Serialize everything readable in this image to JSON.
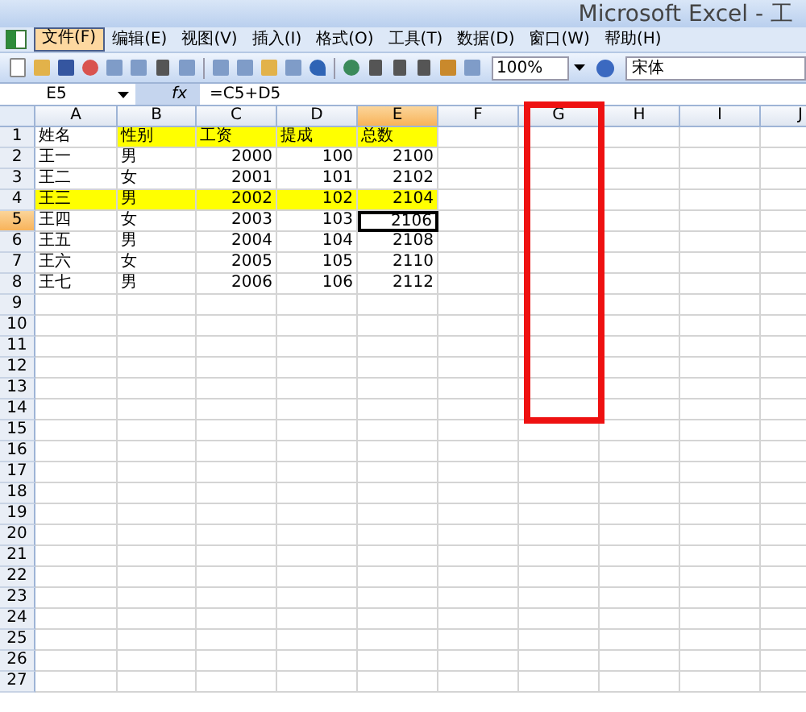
{
  "window": {
    "title": "Microsoft Excel - 工"
  },
  "menu": [
    {
      "label": "文件(F)",
      "selected": true
    },
    {
      "label": "编辑(E)",
      "selected": false
    },
    {
      "label": "视图(V)",
      "selected": false
    },
    {
      "label": "插入(I)",
      "selected": false
    },
    {
      "label": "格式(O)",
      "selected": false
    },
    {
      "label": "工具(T)",
      "selected": false
    },
    {
      "label": "数据(D)",
      "selected": false
    },
    {
      "label": "窗口(W)",
      "selected": false
    },
    {
      "label": "帮助(H)",
      "selected": false
    }
  ],
  "toolbar": {
    "zoom": "100%",
    "font": "宋体"
  },
  "formula_bar": {
    "name_box": "E5",
    "fx": "fx",
    "formula": "=C5+D5"
  },
  "columns": [
    {
      "label": "A",
      "selected": false
    },
    {
      "label": "B",
      "selected": false
    },
    {
      "label": "C",
      "selected": false
    },
    {
      "label": "D",
      "selected": false
    },
    {
      "label": "E",
      "selected": true
    },
    {
      "label": "F",
      "selected": false
    },
    {
      "label": "G",
      "selected": false
    },
    {
      "label": "H",
      "selected": false
    },
    {
      "label": "I",
      "selected": false
    },
    {
      "label": "J",
      "selected": false
    }
  ],
  "rows": [
    {
      "number": "1",
      "selected": false,
      "cells": [
        {
          "text": "姓名",
          "kind": "text",
          "highlighted": false,
          "selected": false
        },
        {
          "text": "性别",
          "kind": "text",
          "highlighted": true,
          "selected": false
        },
        {
          "text": "工资",
          "kind": "text",
          "highlighted": true,
          "selected": false
        },
        {
          "text": "提成",
          "kind": "text",
          "highlighted": true,
          "selected": false
        },
        {
          "text": "总数",
          "kind": "text",
          "highlighted": true,
          "selected": false
        }
      ]
    },
    {
      "number": "2",
      "selected": false,
      "cells": [
        {
          "text": "王一",
          "kind": "text",
          "highlighted": false,
          "selected": false
        },
        {
          "text": "男",
          "kind": "text",
          "highlighted": false,
          "selected": false
        },
        {
          "text": "2000",
          "kind": "number",
          "highlighted": false,
          "selected": false
        },
        {
          "text": "100",
          "kind": "number",
          "highlighted": false,
          "selected": false
        },
        {
          "text": "2100",
          "kind": "number",
          "highlighted": false,
          "selected": false
        }
      ]
    },
    {
      "number": "3",
      "selected": false,
      "cells": [
        {
          "text": "王二",
          "kind": "text",
          "highlighted": false,
          "selected": false
        },
        {
          "text": "女",
          "kind": "text",
          "highlighted": false,
          "selected": false
        },
        {
          "text": "2001",
          "kind": "number",
          "highlighted": false,
          "selected": false
        },
        {
          "text": "101",
          "kind": "number",
          "highlighted": false,
          "selected": false
        },
        {
          "text": "2102",
          "kind": "number",
          "highlighted": false,
          "selected": false
        }
      ]
    },
    {
      "number": "4",
      "selected": false,
      "cells": [
        {
          "text": "王三",
          "kind": "text",
          "highlighted": true,
          "selected": false
        },
        {
          "text": "男",
          "kind": "text",
          "highlighted": true,
          "selected": false
        },
        {
          "text": "2002",
          "kind": "number",
          "highlighted": true,
          "selected": false
        },
        {
          "text": "102",
          "kind": "number",
          "highlighted": true,
          "selected": false
        },
        {
          "text": "2104",
          "kind": "number",
          "highlighted": true,
          "selected": false
        }
      ]
    },
    {
      "number": "5",
      "selected": true,
      "cells": [
        {
          "text": "王四",
          "kind": "text",
          "highlighted": false,
          "selected": false
        },
        {
          "text": "女",
          "kind": "text",
          "highlighted": false,
          "selected": false
        },
        {
          "text": "2003",
          "kind": "number",
          "highlighted": false,
          "selected": false
        },
        {
          "text": "103",
          "kind": "number",
          "highlighted": false,
          "selected": false
        },
        {
          "text": "2106",
          "kind": "number",
          "highlighted": false,
          "selected": true
        }
      ]
    },
    {
      "number": "6",
      "selected": false,
      "cells": [
        {
          "text": "王五",
          "kind": "text",
          "highlighted": false,
          "selected": false
        },
        {
          "text": "男",
          "kind": "text",
          "highlighted": false,
          "selected": false
        },
        {
          "text": "2004",
          "kind": "number",
          "highlighted": false,
          "selected": false
        },
        {
          "text": "104",
          "kind": "number",
          "highlighted": false,
          "selected": false
        },
        {
          "text": "2108",
          "kind": "number",
          "highlighted": false,
          "selected": false
        }
      ]
    },
    {
      "number": "7",
      "selected": false,
      "cells": [
        {
          "text": "王六",
          "kind": "text",
          "highlighted": false,
          "selected": false
        },
        {
          "text": "女",
          "kind": "text",
          "highlighted": false,
          "selected": false
        },
        {
          "text": "2005",
          "kind": "number",
          "highlighted": false,
          "selected": false
        },
        {
          "text": "105",
          "kind": "number",
          "highlighted": false,
          "selected": false
        },
        {
          "text": "2110",
          "kind": "number",
          "highlighted": false,
          "selected": false
        }
      ]
    },
    {
      "number": "8",
      "selected": false,
      "cells": [
        {
          "text": "王七",
          "kind": "text",
          "highlighted": false,
          "selected": false
        },
        {
          "text": "男",
          "kind": "text",
          "highlighted": false,
          "selected": false
        },
        {
          "text": "2006",
          "kind": "number",
          "highlighted": false,
          "selected": false
        },
        {
          "text": "106",
          "kind": "number",
          "highlighted": false,
          "selected": false
        },
        {
          "text": "2112",
          "kind": "number",
          "highlighted": false,
          "selected": false
        }
      ]
    },
    {
      "number": "9",
      "selected": false,
      "cells": []
    },
    {
      "number": "10",
      "selected": false,
      "cells": []
    },
    {
      "number": "11",
      "selected": false,
      "cells": []
    },
    {
      "number": "12",
      "selected": false,
      "cells": []
    },
    {
      "number": "13",
      "selected": false,
      "cells": []
    },
    {
      "number": "14",
      "selected": false,
      "cells": []
    },
    {
      "number": "15",
      "selected": false,
      "cells": []
    },
    {
      "number": "16",
      "selected": false,
      "cells": []
    },
    {
      "number": "17",
      "selected": false,
      "cells": []
    },
    {
      "number": "18",
      "selected": false,
      "cells": []
    },
    {
      "number": "19",
      "selected": false,
      "cells": []
    },
    {
      "number": "20",
      "selected": false,
      "cells": []
    },
    {
      "number": "21",
      "selected": false,
      "cells": []
    },
    {
      "number": "22",
      "selected": false,
      "cells": []
    },
    {
      "number": "23",
      "selected": false,
      "cells": []
    },
    {
      "number": "24",
      "selected": false,
      "cells": []
    },
    {
      "number": "25",
      "selected": false,
      "cells": []
    },
    {
      "number": "26",
      "selected": false,
      "cells": []
    },
    {
      "number": "27",
      "selected": false,
      "cells": []
    }
  ]
}
